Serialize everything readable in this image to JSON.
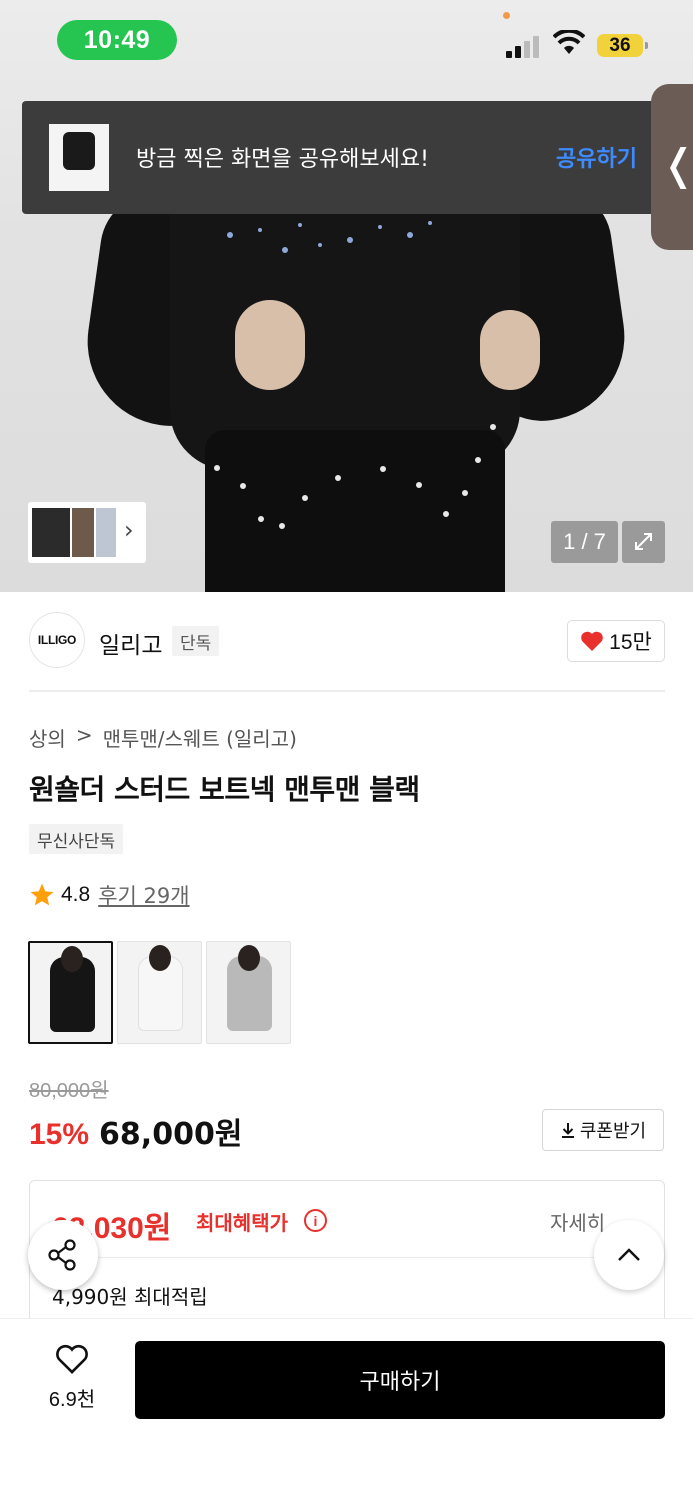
{
  "status_bar": {
    "time": "10:49",
    "battery": "36"
  },
  "toast": {
    "message": "방금 찍은 화면을 공유해보세요!",
    "action": "공유하기"
  },
  "side_tab": {
    "glyph": "❬"
  },
  "gallery": {
    "page": "1 / 7"
  },
  "brand": {
    "logo_text": "ILLIGO",
    "name": "일리고",
    "tag": "단독",
    "likes": "15만"
  },
  "breadcrumb": {
    "items": [
      "상의",
      "맨투맨/스웨트 (일리고)"
    ],
    "separator": ">"
  },
  "product": {
    "title": "원숄더 스터드 보트넥 맨투맨 블랙",
    "exclusive_badge": "무신사단독",
    "rating": "4.8",
    "reviews": "후기 29개",
    "variants": [
      "black",
      "white",
      "grey"
    ]
  },
  "price": {
    "original": "80,000원",
    "discount_rate": "15%",
    "sale": "68,000원",
    "coupon_label": "쿠폰받기"
  },
  "benefit": {
    "max_price": "62,030원",
    "max_label": "최대혜택가",
    "detail_label": "자세히",
    "points": "4,990원 최대적립"
  },
  "bottom": {
    "wish_count": "6.9천",
    "buy_label": "구매하기"
  },
  "colors": {
    "accent_red": "#e8302c",
    "link_blue": "#3d8bff",
    "status_green": "#26c451",
    "buy_black": "#000000"
  }
}
